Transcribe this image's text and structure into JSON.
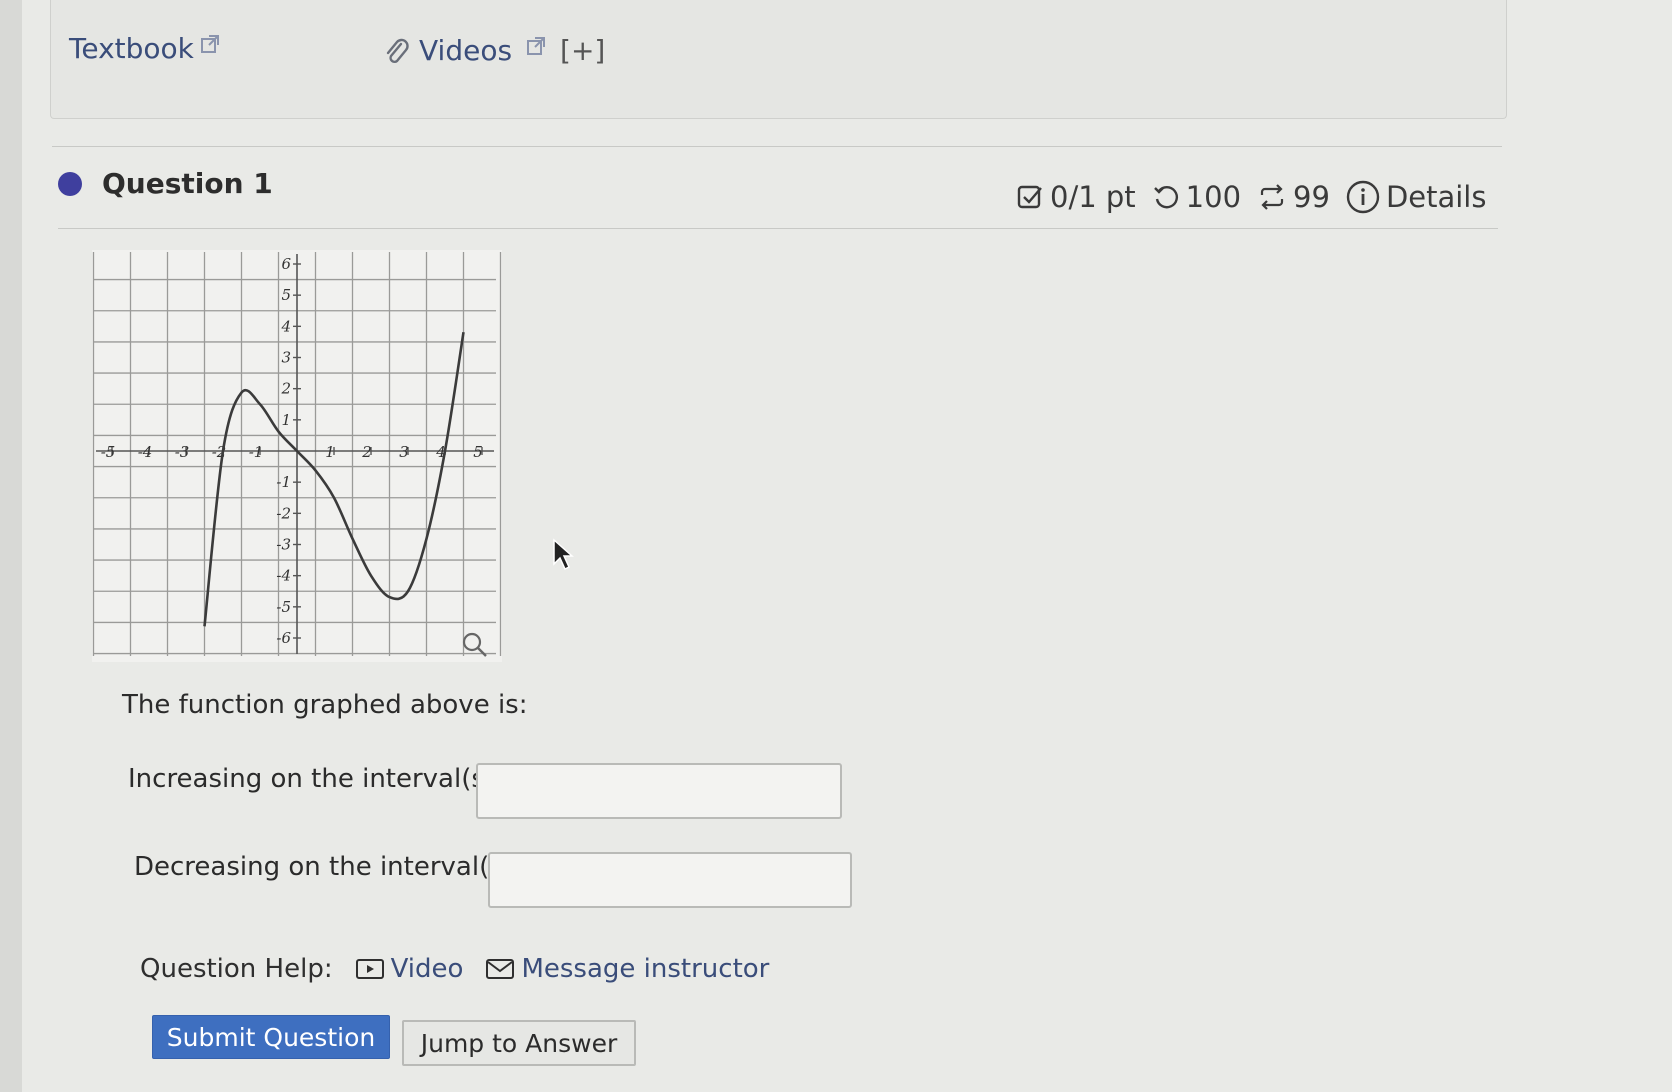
{
  "resources": {
    "textbook_label": "Textbook",
    "videos_label": "Videos",
    "expand_label": "[+]"
  },
  "question": {
    "title": "Question 1",
    "points": "0/1 pt",
    "retries": "100",
    "submissions": "99",
    "details_label": "Details"
  },
  "chart_data": {
    "type": "line",
    "title": "",
    "xlabel": "",
    "ylabel": "",
    "xlim": [
      -5,
      5
    ],
    "ylim": [
      -6,
      6
    ],
    "x_ticks": [
      "-5",
      "-4",
      "-3",
      "-2",
      "-1",
      "1",
      "2",
      "3",
      "4",
      "5"
    ],
    "y_ticks": [
      "6",
      "5",
      "4",
      "3",
      "2",
      "1",
      "-1",
      "-2",
      "-3",
      "-4",
      "-5",
      "-6"
    ],
    "grid": true,
    "series": [
      {
        "x": [
          -2.5,
          -2.0,
          -1.5,
          -1.0,
          -0.5,
          0.0,
          0.5,
          1.0,
          1.5,
          2.0,
          2.5,
          3.0,
          3.5,
          4.0,
          4.5
        ],
        "y": [
          -5.625,
          0.0,
          1.875,
          1.5,
          0.625,
          0.0,
          -0.625,
          -1.5,
          -2.8125,
          -4.0,
          -4.6875,
          -4.5,
          -2.8125,
          0.0,
          3.8125
        ]
      }
    ],
    "color": "#3b3b3b"
  },
  "prompt_text": "The function graphed above is:",
  "increasing_label": "Increasing on the interval(s)",
  "decreasing_label": "Decreasing on the interval(s)",
  "increasing_value": "",
  "decreasing_value": "",
  "help": {
    "label": "Question Help:",
    "video_label": "Video",
    "message_label": "Message instructor"
  },
  "buttons": {
    "submit_label": "Submit Question",
    "jump_label": "Jump to Answer"
  }
}
